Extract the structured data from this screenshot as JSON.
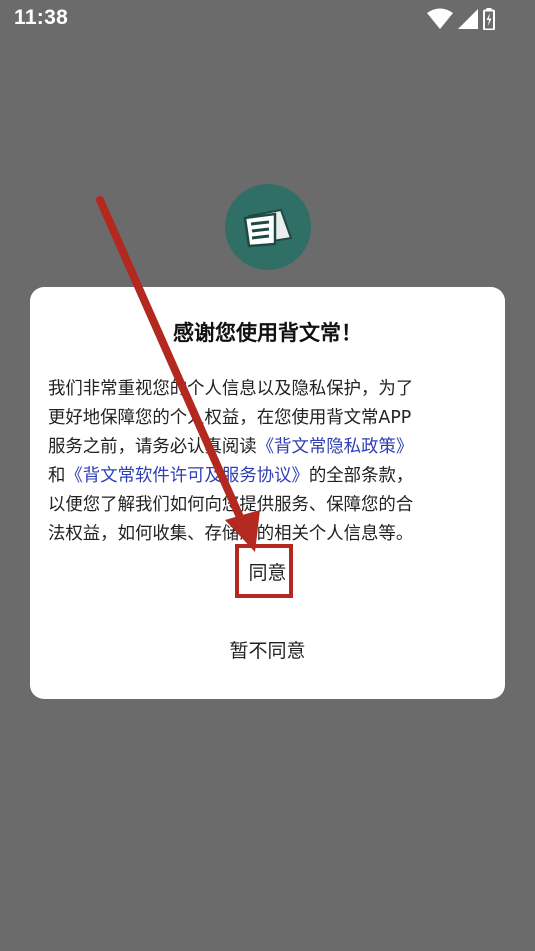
{
  "status_bar": {
    "time": "11:38",
    "icons": [
      "wifi-icon",
      "signal-icon",
      "battery-charging-icon"
    ]
  },
  "app": {
    "logo_icon": "book-icon",
    "logo_color": "#2f6f66"
  },
  "dialog": {
    "title": "感谢您使用背文常！",
    "body": {
      "line1": "我们非常重视您的个人信息以及隐私保护，为了",
      "line2": "更好地保障您的个人权益，在您使用背文常APP",
      "line3_prefix": "服务之前，请务必认真阅读",
      "privacy_link": "《背文常隐私政策》",
      "line4_prefix": "和",
      "license_link": "《背文常软件许可及服务协议》",
      "line4_suffix": "的全部条款，",
      "line5": "以便您了解我们如何向您提供服务、保障您的合",
      "line6": "法权益，如何收集、存储您的相关个人信息等。"
    },
    "agree_label": "同意",
    "disagree_label": "暂不同意"
  },
  "colors": {
    "overlay": "#6b6b6b",
    "link": "#2f3fb5",
    "annotation": "#b3281f"
  }
}
